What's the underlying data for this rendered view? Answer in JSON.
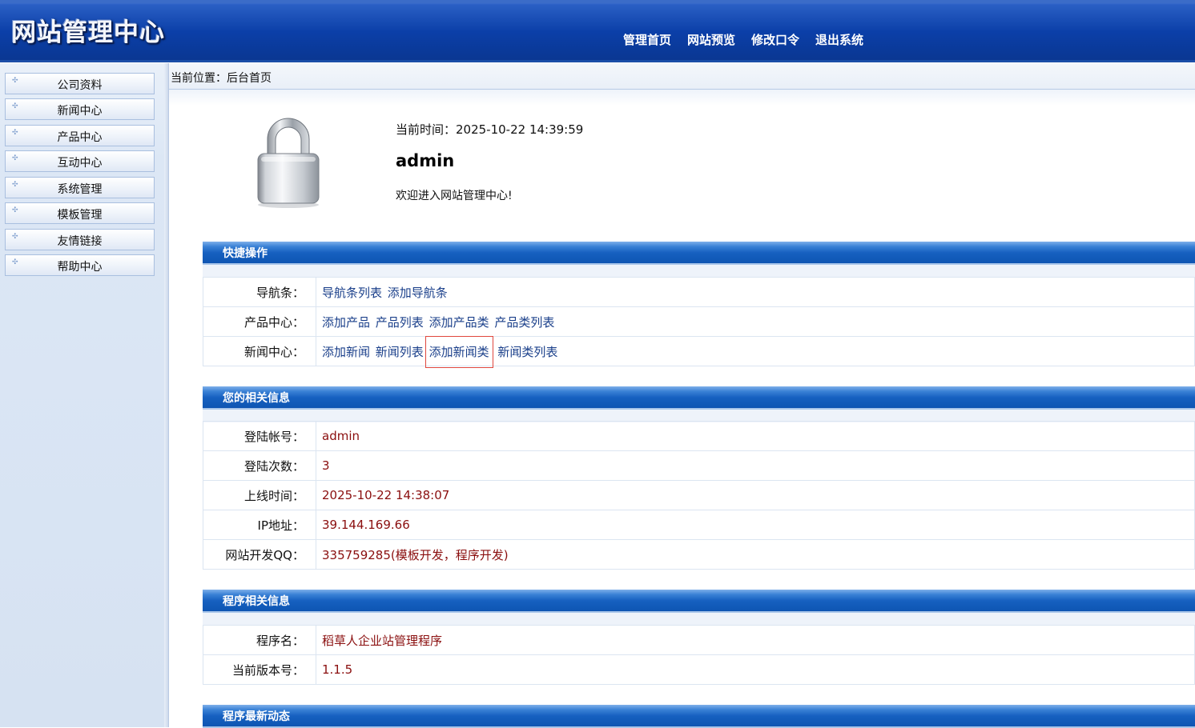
{
  "header": {
    "logo_text": "网站管理中心",
    "nav": [
      "管理首页",
      "网站预览",
      "修改口令",
      "退出系统"
    ]
  },
  "sidebar": {
    "items": [
      "公司资料",
      "新闻中心",
      "产品中心",
      "互动中心",
      "系统管理",
      "模板管理",
      "友情链接",
      "帮助中心"
    ]
  },
  "breadcrumb": "当前位置：后台首页",
  "welcome": {
    "time_text": "当前时间：2025-10-22 14:39:59",
    "username": "admin",
    "message": "欢迎进入网站管理中心!"
  },
  "quick": {
    "title": "快捷操作",
    "rows": [
      {
        "label": "导航条：",
        "links": [
          "导航条列表",
          "添加导航条"
        ]
      },
      {
        "label": "产品中心：",
        "links": [
          "添加产品",
          "产品列表",
          "添加产品类",
          "产品类列表"
        ]
      },
      {
        "label": "新闻中心：",
        "links": [
          "添加新闻",
          "新闻列表",
          "添加新闻类",
          "新闻类列表"
        ]
      }
    ]
  },
  "account": {
    "title": "您的相关信息",
    "rows": [
      {
        "label": "登陆帐号：",
        "value": "admin"
      },
      {
        "label": "登陆次数：",
        "value": "3"
      },
      {
        "label": "上线时间：",
        "value": "2025-10-22 14:38:07"
      },
      {
        "label": "IP地址：",
        "value": "39.144.169.66"
      },
      {
        "label": "网站开发QQ：",
        "value": "335759285(模板开发，程序开发)"
      }
    ]
  },
  "program": {
    "title": "程序相关信息",
    "rows": [
      {
        "label": "程序名：",
        "value": "稻草人企业站管理程序"
      },
      {
        "label": "当前版本号：",
        "value": "1.1.5"
      }
    ]
  },
  "news": {
    "title": "程序最新动态"
  },
  "icons": {
    "welcome": "padlock-icon",
    "menu_bullet": "plus-bullet-icon"
  },
  "colors": {
    "header": "#0b3fa8",
    "section_bar": "#1660c0",
    "value_text": "#8a0e0e",
    "link_text": "#1a3f8a",
    "highlight": "#e0473d"
  }
}
